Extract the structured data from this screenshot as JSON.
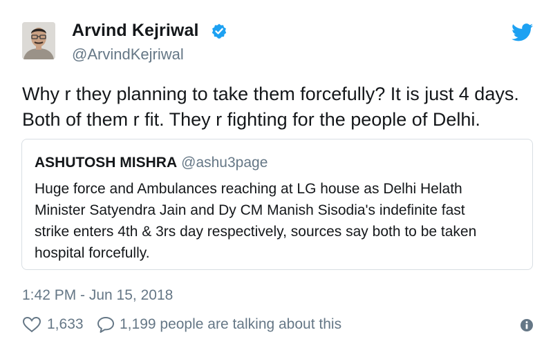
{
  "author": {
    "display_name": "Arvind Kejriwal",
    "handle": "@ArvindKejriwal",
    "verified": true,
    "avatar_icon": "profile-photo"
  },
  "tweet": {
    "text_lines": [
      "Why r they planning to take them forcefully? It is just 4 days.",
      "Both of them r fit. They r fighting for the people of Delhi."
    ]
  },
  "quoted_tweet": {
    "display_name": "ASHUTOSH MISHRA",
    "handle": "@ashu3page",
    "text_lines": [
      "Huge force and Ambulances reaching at LG house as Delhi Helath",
      "Minister Satyendra Jain and Dy CM Manish Sisodia's indefinite fast",
      "strike enters 4th & 3rs day respectively, sources say both to be taken",
      "hospital forcefully."
    ]
  },
  "timestamp": "1:42 PM - Jun 15, 2018",
  "actions": {
    "likes": "1,633",
    "conversation": "1,199 people are talking about this"
  },
  "colors": {
    "text": "#14171a",
    "secondary": "#657786",
    "brand_blue": "#1da1f2",
    "border": "#d8dee3"
  },
  "icons": {
    "verified": "verified-badge-icon",
    "brand": "twitter-bird-icon",
    "like": "heart-icon",
    "reply": "speech-bubble-icon",
    "info": "info-icon"
  }
}
